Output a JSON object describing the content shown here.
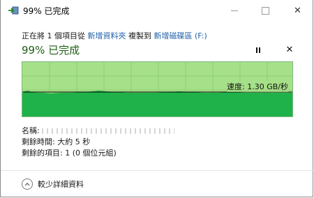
{
  "window": {
    "title": "99% 已完成",
    "controls": {
      "minimize": "—",
      "maximize": "□",
      "close": "✕"
    }
  },
  "copy": {
    "prefix": "正在將 1 個項目從 ",
    "source": "新增資料夾",
    "middle": " 複製到 ",
    "destination": "新增磁碟區 (F:)"
  },
  "progress": {
    "heading": "99% 已完成",
    "percent": 99,
    "speed_label": "速度: 1.30 GB/秒"
  },
  "details": {
    "name_label": "名稱: ",
    "time_remaining": "剩餘時間: 大約 5 秒",
    "items_remaining": "剩餘的項目: 1 (0 個位元組)"
  },
  "toggle": {
    "label": "較少詳細資料"
  },
  "colors": {
    "graph_bg": "#a6e089",
    "graph_fill": "#1fb24b",
    "heading": "#1e5e14",
    "link": "#1e5fa8"
  }
}
